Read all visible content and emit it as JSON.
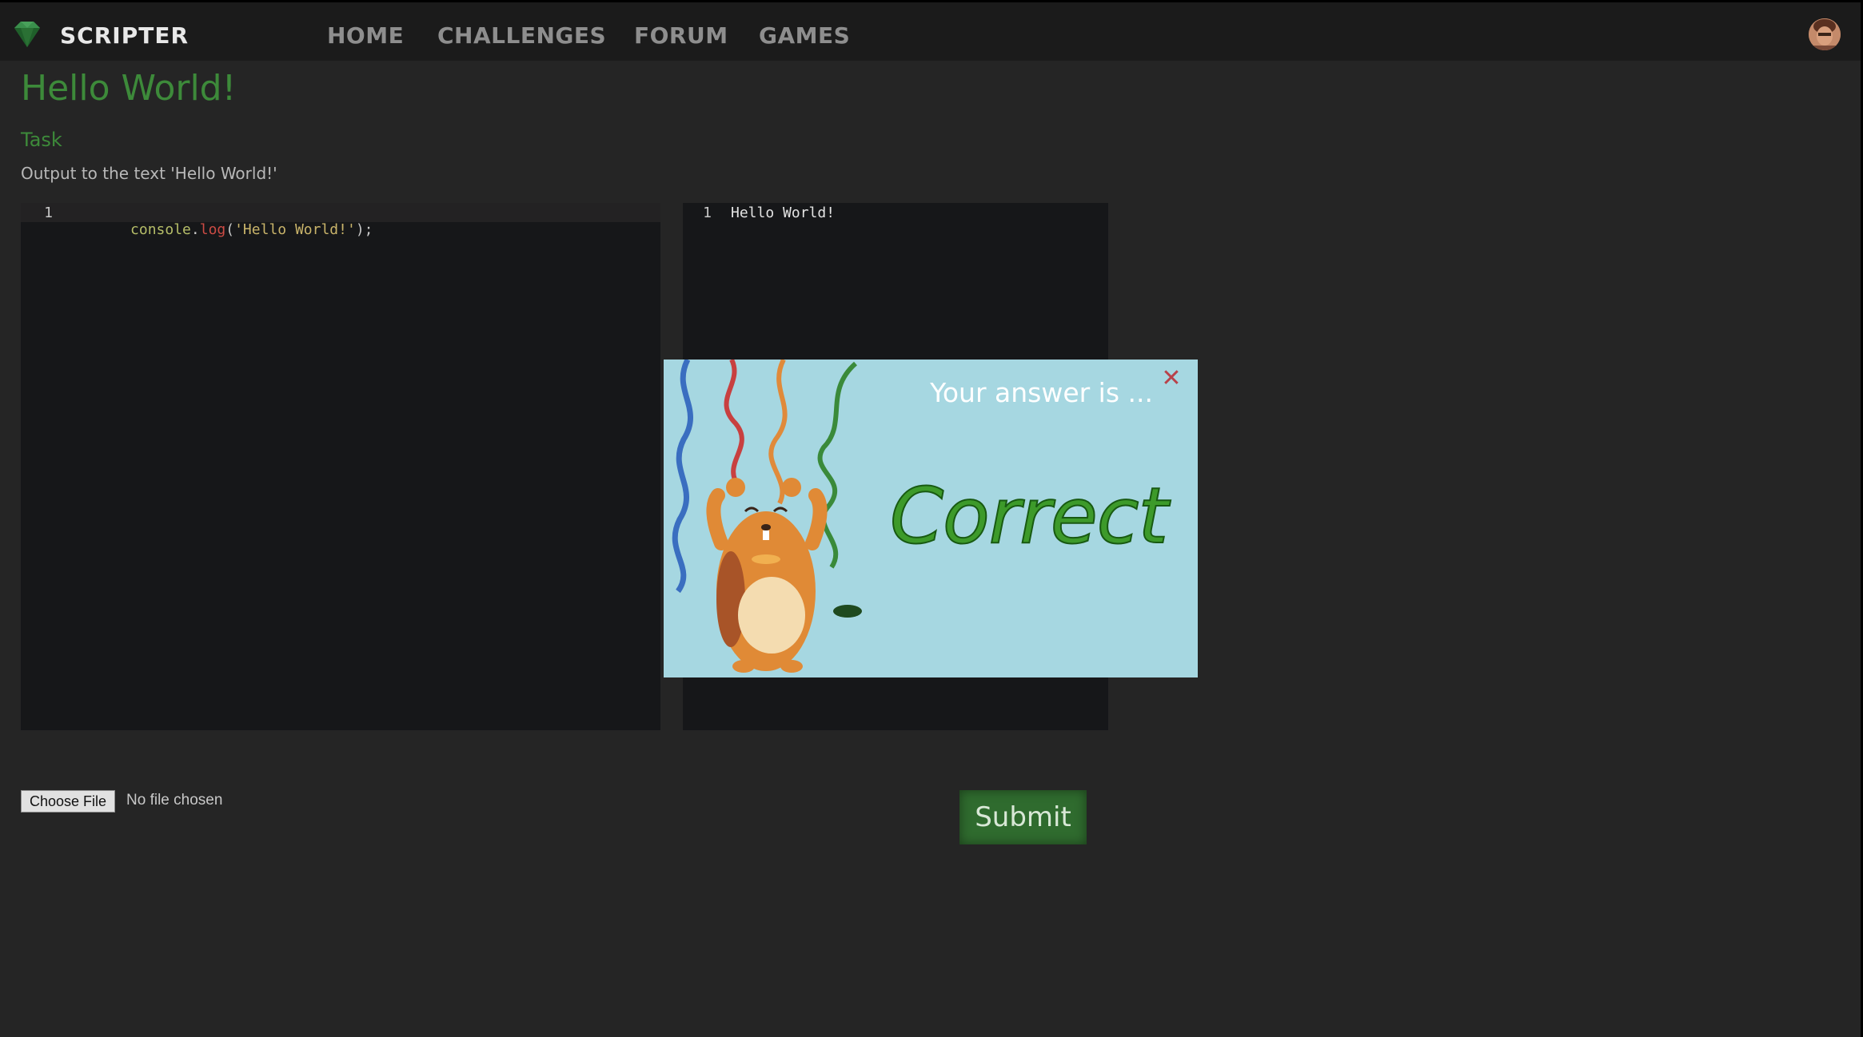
{
  "header": {
    "brand": "SCRIPTER",
    "nav": [
      "HOME",
      "CHALLENGES",
      "FORUM",
      "GAMES"
    ]
  },
  "page": {
    "title": "Hello World!",
    "task_heading": "Task",
    "task_text": "Output to the text 'Hello World!'"
  },
  "editor": {
    "line_number": "1",
    "code_tokens": [
      {
        "text": "console",
        "color": "#b5bd68"
      },
      {
        "text": ".",
        "color": "#c8c8c8"
      },
      {
        "text": "log",
        "color": "#cc4b44"
      },
      {
        "text": "(",
        "color": "#c8c8c8"
      },
      {
        "text": "'Hello World!'",
        "color": "#c9b46a"
      },
      {
        "text": ");",
        "color": "#c8c8c8"
      }
    ]
  },
  "output": {
    "line_number": "1",
    "text": "Hello World!"
  },
  "file_input": {
    "button_label": "Choose File",
    "status": "No file chosen"
  },
  "submit_label": "Submit",
  "modal": {
    "title": "Your answer is ...",
    "result": "Correct",
    "close_glyph": "✕"
  },
  "colors": {
    "accent_green": "#3d8a3a",
    "modal_bg": "#a6d7e1",
    "close_red": "#b8424a"
  }
}
